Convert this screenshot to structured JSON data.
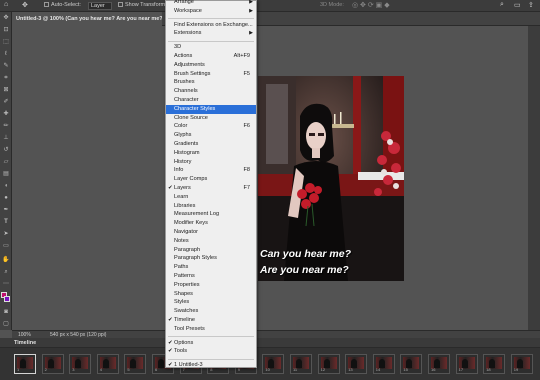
{
  "options_bar": {
    "auto_select_label": "Auto-Select:",
    "auto_select_value": "Layer",
    "show_transform_label": "Show Transform",
    "three_d_mode_label": "3D Mode:"
  },
  "document_tab": {
    "title": "Untitled-3 @ 100% (Can you hear me?  Are you near me?, R"
  },
  "status_bar": {
    "zoom": "100%",
    "doc_info": "540 px x 540 px (120 ppi)"
  },
  "timeline": {
    "panel_title": "Timeline",
    "frame_labels": [
      "1",
      "2",
      "3",
      "4",
      "5",
      "6",
      "7",
      "8",
      "9",
      "10",
      "11",
      "12",
      "13",
      "14",
      "15",
      "16",
      "17",
      "18",
      "19"
    ]
  },
  "canvas": {
    "caption_line1": "Can you hear me?",
    "caption_line2": "Are you near me?"
  },
  "window_menu": {
    "items": [
      {
        "label": "Arrange",
        "submenu": true
      },
      {
        "label": "Workspace",
        "submenu": true
      },
      {
        "separator": true
      },
      {
        "label": "Find Extensions on Exchange..."
      },
      {
        "label": "Extensions",
        "submenu": true
      },
      {
        "separator": true
      },
      {
        "label": "3D"
      },
      {
        "label": "Actions",
        "shortcut": "Alt+F9"
      },
      {
        "label": "Adjustments"
      },
      {
        "label": "Brush Settings",
        "shortcut": "F5"
      },
      {
        "label": "Brushes"
      },
      {
        "label": "Channels"
      },
      {
        "label": "Character"
      },
      {
        "label": "Character Styles",
        "highlighted": true
      },
      {
        "label": "Clone Source"
      },
      {
        "label": "Color",
        "shortcut": "F6"
      },
      {
        "label": "Glyphs"
      },
      {
        "label": "Gradients"
      },
      {
        "label": "Histogram"
      },
      {
        "label": "History"
      },
      {
        "label": "Info",
        "shortcut": "F8"
      },
      {
        "label": "Layer Comps"
      },
      {
        "label": "Layers",
        "shortcut": "F7",
        "checked": true
      },
      {
        "label": "Learn"
      },
      {
        "label": "Libraries"
      },
      {
        "label": "Measurement Log"
      },
      {
        "label": "Modifier Keys"
      },
      {
        "label": "Navigator"
      },
      {
        "label": "Notes"
      },
      {
        "label": "Paragraph"
      },
      {
        "label": "Paragraph Styles"
      },
      {
        "label": "Paths"
      },
      {
        "label": "Patterns"
      },
      {
        "label": "Properties"
      },
      {
        "label": "Shapes"
      },
      {
        "label": "Styles"
      },
      {
        "label": "Swatches"
      },
      {
        "label": "Timeline",
        "checked": true
      },
      {
        "label": "Tool Presets"
      },
      {
        "separator": true
      },
      {
        "label": "Options",
        "checked": true
      },
      {
        "label": "Tools",
        "checked": true
      },
      {
        "separator": true
      },
      {
        "label": "1 Untitled-3",
        "checked": true
      }
    ]
  },
  "tools": [
    "move-tool",
    "artboard-tool",
    "marquee-tool",
    "lasso-tool",
    "quick-select-tool",
    "crop-tool",
    "frame-tool",
    "eyedropper-tool",
    "healing-tool",
    "brush-tool",
    "stamp-tool",
    "history-brush-tool",
    "eraser-tool",
    "gradient-tool",
    "blur-tool",
    "dodge-tool",
    "pen-tool",
    "type-tool",
    "path-select-tool",
    "rectangle-tool",
    "hand-tool",
    "zoom-tool"
  ]
}
